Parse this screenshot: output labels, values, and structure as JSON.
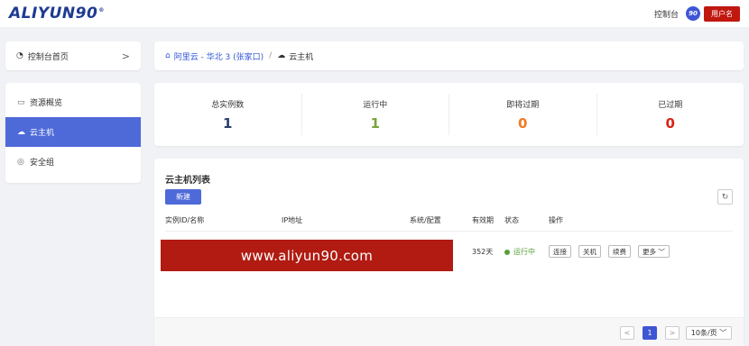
{
  "header": {
    "logo_text": "ALIYUN90",
    "logo_mark": "®",
    "console_label": "控制台",
    "avatar_text": "90",
    "username": "用户名"
  },
  "home_nav": {
    "label": "控制台首页",
    "icon": "dashboard-icon",
    "chevron": ">"
  },
  "breadcrumb": {
    "home_icon": "home-icon",
    "region": "阿里云 - 华北 3 (张家口)",
    "separator": "/",
    "current": "云主机",
    "current_icon": "cloud-icon"
  },
  "sidebar": {
    "items": [
      {
        "label": "资源概览",
        "icon": "monitor-icon",
        "glyph": "▭",
        "active": false
      },
      {
        "label": "云主机",
        "icon": "cloud-icon",
        "glyph": "☁",
        "active": true
      },
      {
        "label": "安全组",
        "icon": "shield-icon",
        "glyph": "◎",
        "active": false
      }
    ]
  },
  "stats": [
    {
      "label": "总实例数",
      "value": "1",
      "color": "#2c3e6b"
    },
    {
      "label": "运行中",
      "value": "1",
      "color": "#7aa33a"
    },
    {
      "label": "即将过期",
      "value": "0",
      "color": "#f07b24"
    },
    {
      "label": "已过期",
      "value": "0",
      "color": "#d8231a"
    }
  ],
  "instance_list": {
    "title": "云主机列表",
    "new_button": "新建",
    "refresh_icon": "refresh-icon",
    "columns": [
      "实例ID/名称",
      "IP地址",
      "系统/配置",
      "有效期",
      "状态",
      "操作"
    ],
    "rows": [
      {
        "redacted_overlay": "www.aliyun90.com",
        "validity": "352天",
        "status": "运行中",
        "actions": [
          "连接",
          "关机",
          "续费",
          "更多 ﹀"
        ]
      }
    ]
  },
  "pagination": {
    "prev": "<",
    "current_page": "1",
    "next": ">",
    "page_size": "10条/页 ﹀"
  },
  "colors": {
    "accent": "#4e6ad9",
    "brand_red": "#c0180f",
    "running": "#5a9e3a"
  }
}
